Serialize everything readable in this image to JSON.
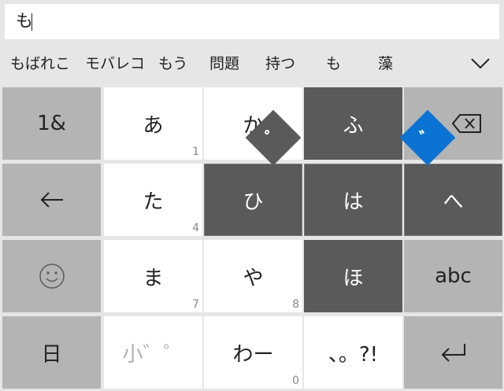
{
  "input": {
    "value": "も"
  },
  "candidates": [
    "もばれこ",
    "モバレコ",
    "もう",
    "問題",
    "持つ",
    "も",
    "藻"
  ],
  "candidates_expand_icon": "chevron-down-icon",
  "keys": {
    "symbols": "1&",
    "a": "あ",
    "a_num": "1",
    "ka": "か",
    "backspace_icon": "backspace-icon",
    "left_arrow_icon": "left-arrow-icon",
    "ta": "た",
    "ta_num": "4",
    "ma": "ま",
    "ma_num": "7",
    "ya": "や",
    "ya_num": "8",
    "emoji_icon": "smiley-icon",
    "abc": "abc",
    "hi": "日",
    "small": "小゛゜",
    "wa": "わー",
    "wa_num": "0",
    "punct": "、。?!",
    "enter_icon": "enter-icon"
  },
  "flick": {
    "center": "は",
    "up": "ふ",
    "left": "ひ",
    "right": "へ",
    "down": "ほ",
    "handakuten": "゜",
    "dakuten": "゛"
  },
  "colors": {
    "dark_key": "#5a5a5a",
    "gray_key": "#b4b4b4",
    "accent": "#0a73d4"
  }
}
